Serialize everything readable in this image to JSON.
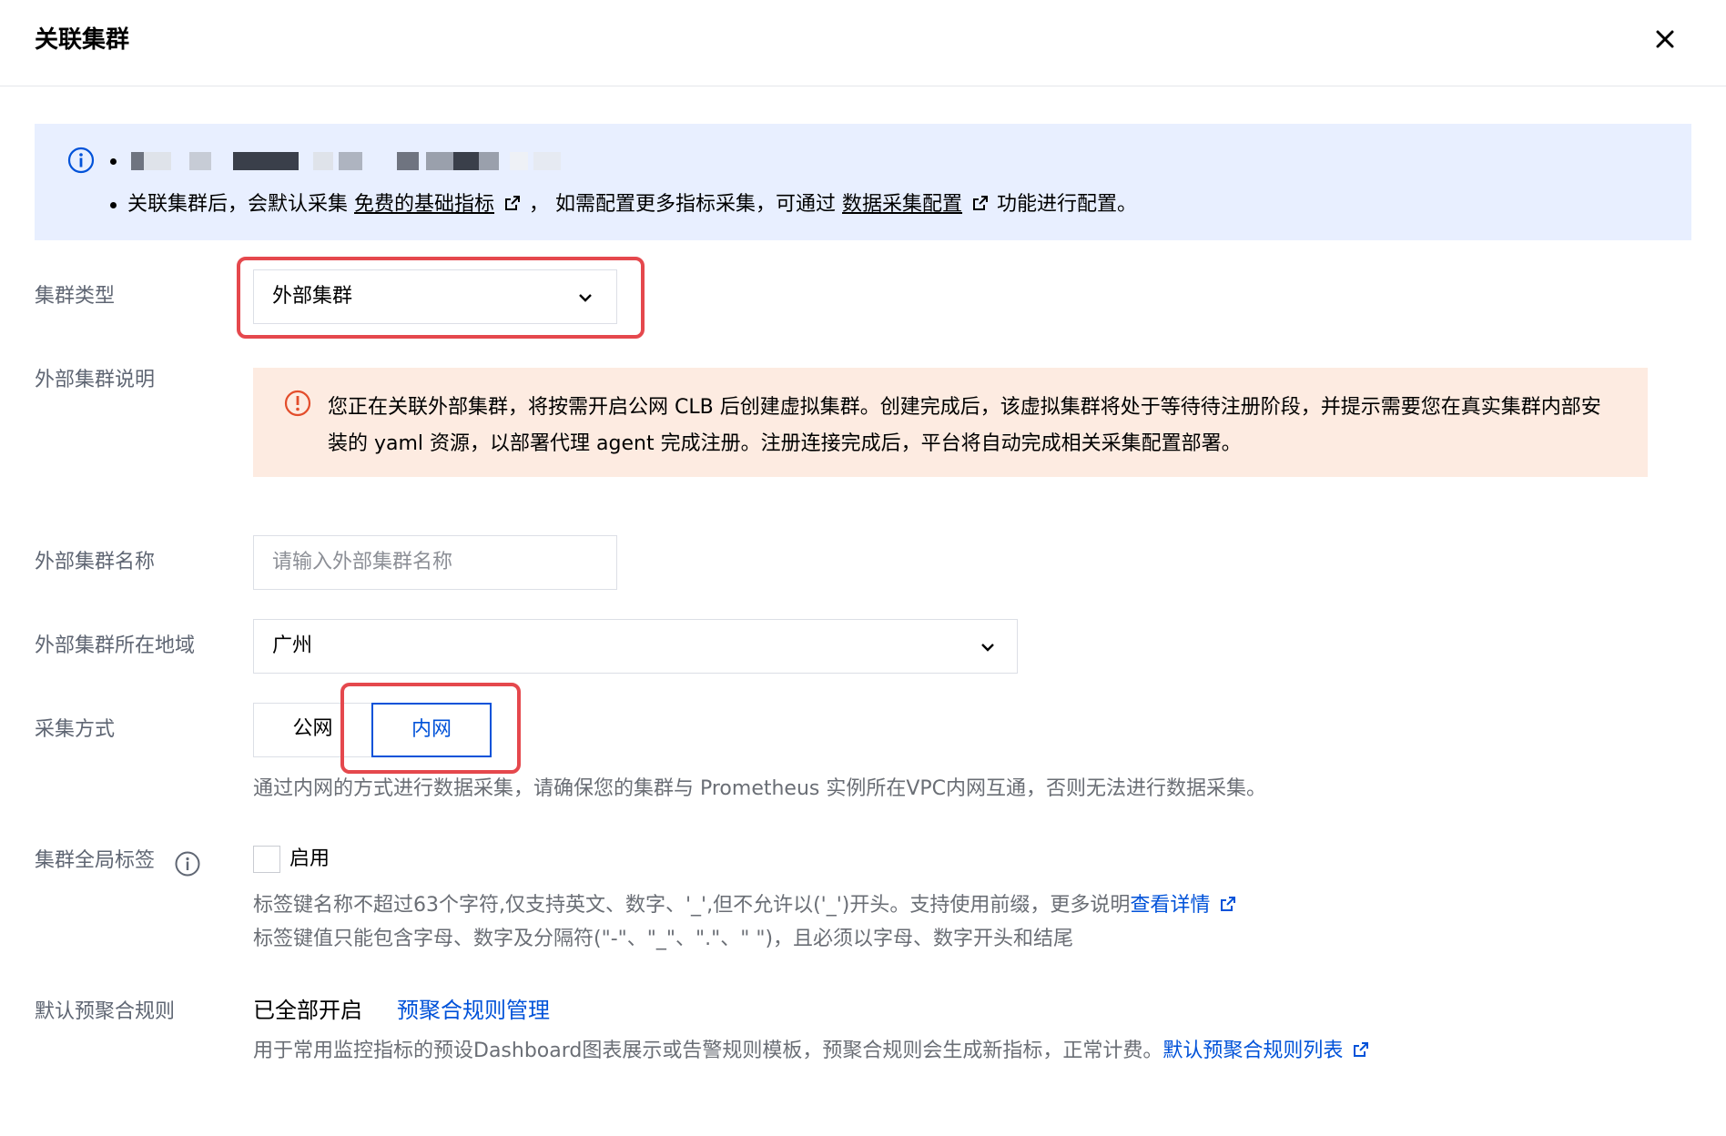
{
  "header": {
    "title": "关联集群"
  },
  "info": {
    "line2_prefix": "关联集群后，会默认采集",
    "line2_link1": "免费的基础指标",
    "line2_mid": "，  如需配置更多指标采集，可通过",
    "line2_link2": "数据采集配置",
    "line2_suffix": "功能进行配置。"
  },
  "form": {
    "cluster_type": {
      "label": "集群类型",
      "value": "外部集群"
    },
    "external_desc": {
      "label": "外部集群说明",
      "warning": "您正在关联外部集群，将按需开启公网 CLB 后创建虚拟集群。创建完成后，该虚拟集群将处于等待待注册阶段，并提示需要您在真实集群内部安装的 yaml 资源，以部署代理 agent 完成注册。注册连接完成后，平台将自动完成相关采集配置部署。"
    },
    "external_name": {
      "label": "外部集群名称",
      "placeholder": "请输入外部集群名称"
    },
    "region": {
      "label": "外部集群所在地域",
      "value": "广州"
    },
    "collect_mode": {
      "label": "采集方式",
      "options": [
        "公网",
        "内网"
      ],
      "selected": "内网",
      "help": "通过内网的方式进行数据采集，请确保您的集群与 Prometheus 实例所在VPC内网互通，否则无法进行数据采集。"
    },
    "global_labels": {
      "label": "集群全局标签",
      "checkbox_label": "启用",
      "help1_prefix": "标签键名称不超过63个字符,仅支持英文、数字、'_',但不允许以('_')开头。支持使用前缀，更多说明",
      "help1_link": "查看详情",
      "help2": "标签键值只能包含字母、数字及分隔符(\"-\"、\"_\"、\".\"、\" \")，且必须以字母、数字开头和结尾"
    },
    "pre_agg": {
      "label": "默认预聚合规则",
      "value": "已全部开启",
      "link": "预聚合规则管理",
      "help_prefix": "用于常用监控指标的预设Dashboard图表展示或告警规则模板，预聚合规则会生成新指标，正常计费。",
      "help_link": "默认预聚合规则列表"
    }
  },
  "colors": {
    "primary": "#0052d9",
    "info_bg": "#e8efff",
    "warn_bg": "#fdebe1",
    "warn_icon": "#e34d2b",
    "highlight": "#e5484d"
  }
}
